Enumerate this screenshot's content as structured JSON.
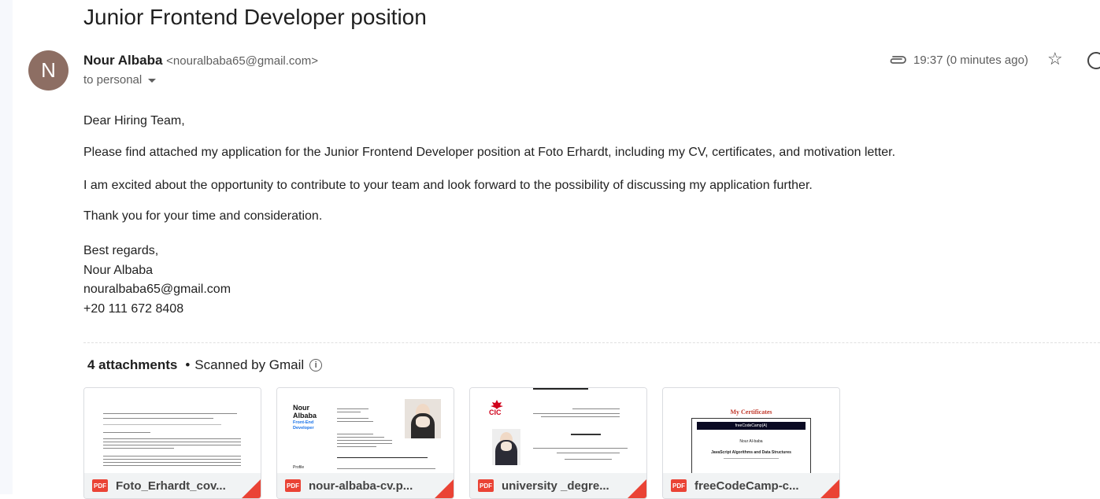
{
  "email": {
    "subject": "Junior Frontend Developer position",
    "avatar_letter": "N",
    "sender_name": "Nour Albaba",
    "sender_email": "<nouralbaba65@gmail.com>",
    "recipient": "to personal",
    "timestamp": "19:37 (0 minutes ago)",
    "body": {
      "greeting": "Dear Hiring Team,",
      "p1": "Please find attached my application for the Junior Frontend Developer position at Foto Erhardt, including my CV, certificates, and motivation letter.",
      "p2": "I am excited about the opportunity to contribute to your team and look forward to the possibility of discussing my application further.",
      "p3": "Thank you for your time and consideration.",
      "closing": "Best regards,",
      "sig_name": "Nour Albaba",
      "sig_email": "nouralbaba65@gmail.com",
      "sig_phone": "+20 111 672 8408"
    }
  },
  "attachments": {
    "count_label": "4 attachments",
    "scanned_label": "Scanned by Gmail",
    "items": [
      {
        "name": "Foto_Erhardt_cov...",
        "type": "PDF"
      },
      {
        "name": "nour-albaba-cv.p...",
        "type": "PDF"
      },
      {
        "name": "university _degre...",
        "type": "PDF"
      },
      {
        "name": "freeCodeCamp-c...",
        "type": "PDF"
      }
    ]
  },
  "thumbs": {
    "cv_name": "Nour Albaba",
    "cv_role": "Front-End Developer",
    "cv_profile": "Profile",
    "cic_logo": "CIC",
    "cert_title": "My Certificates",
    "fcc_brand": "freeCodeCamp(A)",
    "fcc_holder": "Nour Al-baba",
    "fcc_course": "JavaScript Algorithms and Data Structures"
  },
  "icons": {
    "attachment": "paperclip-icon",
    "star": "star-icon",
    "emoji": "emoji-icon",
    "info": "info-icon",
    "pdf": "pdf-icon"
  },
  "colors": {
    "avatar_bg": "#8d6e63",
    "pdf_red": "#ea4335",
    "cv_blue": "#1a73e8"
  }
}
